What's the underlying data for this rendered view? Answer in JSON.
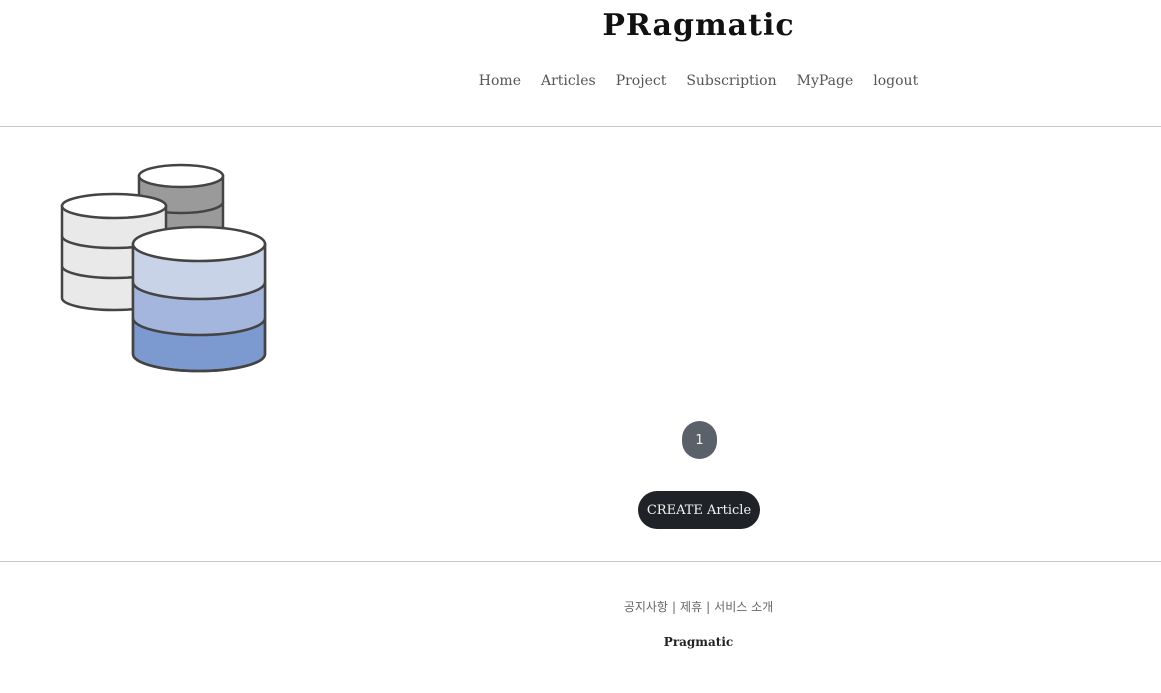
{
  "header": {
    "brand": "PRagmatic",
    "nav": {
      "home": "Home",
      "articles": "Articles",
      "project": "Project",
      "subscription": "Subscription",
      "mypage": "MyPage",
      "logout": "logout"
    }
  },
  "main": {
    "article_image_icon": "database-stack-icon",
    "pagination": {
      "current_page": "1"
    },
    "create_button": "CREATE Article"
  },
  "footer": {
    "links": {
      "notice": "공지사항",
      "partnership": "제휴",
      "service_intro": "서비스 소개",
      "separator": "|"
    },
    "brand": "Pragmatic"
  },
  "colors": {
    "pager_bg": "#5b6169",
    "button_bg": "#1f2226",
    "divider": "#c8c8c8",
    "db_blue_top": "#c9d3e8",
    "db_blue_mid": "#a4b6dd",
    "db_blue_bottom": "#7d9ad0",
    "db_gray": "#9a9a9a",
    "db_light": "#e9e9e9"
  }
}
